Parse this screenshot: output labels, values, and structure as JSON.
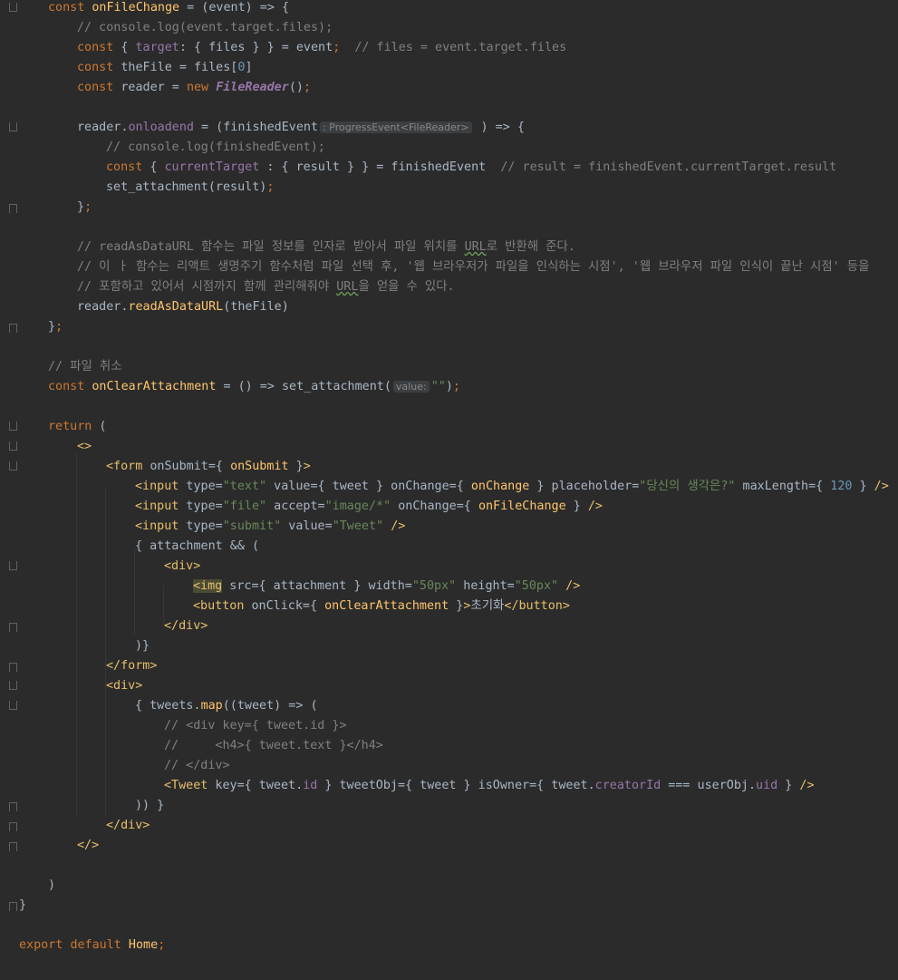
{
  "editor": {
    "language": "JavaScript (React JSX)",
    "colors": {
      "background": "#2b2b2b",
      "keyword": "#cc7832",
      "function": "#ffc66d",
      "comment": "#808080",
      "string": "#6a8759",
      "number": "#6897bb",
      "property": "#9876aa",
      "tag": "#e8bf6a",
      "text": "#a9b7c6"
    },
    "hints": {
      "progress_event": ": ProgressEvent<FileReader>",
      "value": "value:"
    },
    "lines": [
      [
        "const",
        " ",
        "onFileChange",
        " = (event) => {"
      ],
      [
        "// console.log(event.target.files);"
      ],
      [
        "const",
        " { ",
        "target",
        ": { files } } = event",
        ";",
        "  // files = event.target.files"
      ],
      [
        "const",
        " theFile = files[",
        "0",
        "]"
      ],
      [
        "const",
        " reader = ",
        "new",
        " ",
        "FileReader",
        "()",
        ";"
      ],
      [],
      [
        "reader.",
        "onloadend",
        " = (finishedEvent",
        " ) => {"
      ],
      [
        "// console.log(finishedEvent);"
      ],
      [
        "const",
        " { ",
        "currentTarget",
        " : { result } } = finishedEvent  ",
        "// result = finishedEvent.currentTarget.result"
      ],
      [
        "set_attachment(result)",
        ";"
      ],
      [
        "}",
        ";"
      ],
      [],
      [
        "// readAsDataURL 함수는 파일 정보를 인자로 받아서 파일 위치를 ",
        "URL",
        "로 반환해 준다."
      ],
      [
        "// 이 ㅏ 함수는 리액트 생명주기 함수처럼 파일 선택 후, '웹 브라우저가 파일을 인식하는 시점', '웹 브라우저 파일 인식이 끝난 시점' 등을"
      ],
      [
        "// 포함하고 있어서 시점까지 함께 관리해줘야 ",
        "URL",
        "을 얻을 수 있다."
      ],
      [
        "reader.",
        "readAsDataURL",
        "(theFile)"
      ],
      [
        "}",
        ";"
      ],
      [],
      [
        "// 파일 취소"
      ],
      [
        "const",
        " ",
        "onClearAttachment",
        " = () => set_attachment(",
        "\"\"",
        ")",
        ";"
      ],
      [],
      [
        "return",
        " ("
      ],
      [
        "<>"
      ],
      [
        "<form",
        " onSubmit={ ",
        "onSubmit",
        " }",
        ">"
      ],
      [
        "<input",
        " type=",
        "\"text\"",
        " value={ tweet } onChange={ ",
        "onChange",
        " } placeholder=",
        "\"당신의 생각은?\"",
        " maxLength={ ",
        "120",
        " } ",
        "/>"
      ],
      [
        "<input",
        " type=",
        "\"file\"",
        " accept=",
        "\"image/*\"",
        " onChange={ ",
        "onFileChange",
        " } ",
        "/>"
      ],
      [
        "<input",
        " type=",
        "\"submit\"",
        " value=",
        "\"Tweet\"",
        " ",
        "/>"
      ],
      [
        "{ attachment && ("
      ],
      [
        "<div>"
      ],
      [
        "<img",
        " src={ attachment } width=",
        "\"50px\"",
        " height=",
        "\"50px\"",
        " ",
        "/>"
      ],
      [
        "<button",
        " onClick={ ",
        "onClearAttachment",
        " }",
        ">",
        "초기화",
        "</button>"
      ],
      [
        "</div>"
      ],
      [
        ")}"
      ],
      [
        "</form>"
      ],
      [
        "<div>"
      ],
      [
        "{ tweets.",
        "map",
        "((tweet) => ("
      ],
      [
        "// <div key={ tweet.id }>"
      ],
      [
        "//     <h4>{ tweet.text }</h4>"
      ],
      [
        "// </div>"
      ],
      [
        "<Tweet",
        " key={ tweet.",
        "id",
        " } tweetObj={ tweet } isOwner={ tweet.",
        "creatorId",
        " === userObj.",
        "uid",
        " } ",
        "/>"
      ],
      [
        ")) }"
      ],
      [
        "</div>"
      ],
      [
        "</>"
      ],
      [],
      [
        ")"
      ],
      [
        "}"
      ],
      [],
      [
        "export",
        " ",
        "default",
        " Home",
        ";"
      ]
    ]
  }
}
